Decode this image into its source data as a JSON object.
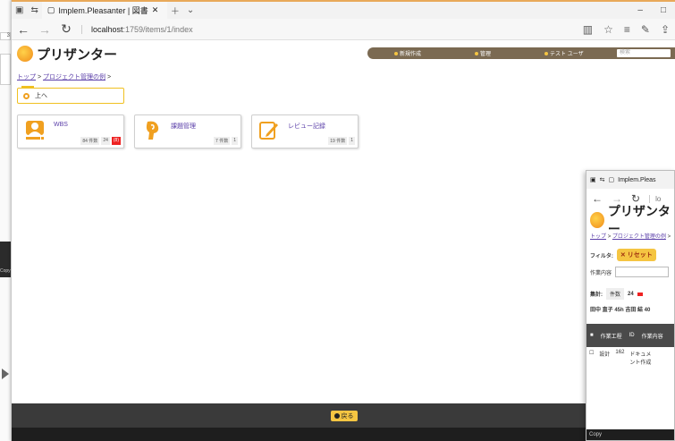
{
  "background_window": {
    "fragment_text": "3",
    "copyright_fragment": "Copy"
  },
  "browser": {
    "tab_title": "Implem.Pleasanter | 図書",
    "url_host": "localhost",
    "url_path": ":1759/items/1/index",
    "icons": [
      "back-icon",
      "forward-icon",
      "refresh-icon",
      "reading-view-icon",
      "favorite-icon",
      "hub-icon",
      "notes-icon",
      "share-icon"
    ]
  },
  "app": {
    "logo": "プリザンター",
    "menu": {
      "new": "新規作成",
      "manage": "管理",
      "user": "テスト ユーザ",
      "search_placeholder": "検索"
    },
    "breadcrumb": {
      "top": "トップ",
      "sep1": ">",
      "project": "プロジェクト管理の例",
      "sep2": ">"
    },
    "up_button": "上へ",
    "cards": [
      {
        "title": "WBS",
        "count_label": "84 件数",
        "n": "24",
        "badge": "(8)"
      },
      {
        "title": "課題管理",
        "count_label": "7 件数",
        "n": "1",
        "badge": ""
      },
      {
        "title": "レビュー記録",
        "count_label": "19 件数",
        "n": "1",
        "badge": ""
      }
    ],
    "back_button": "戻る",
    "copyright": "Copy"
  },
  "overlay_window": {
    "tab_title": "Implem.Pleas",
    "url": "lo",
    "logo": "プリザンター",
    "breadcrumb_top": "トップ",
    "breadcrumb_sep": ">",
    "breadcrumb_project": "プロジェクト管理の例",
    "filter_label": "フィルタ:",
    "reset_button": "リセット",
    "field_label": "作業内容",
    "summary_label": "集計:",
    "count_label": "件数",
    "count_value": "24",
    "names": "田中 直子 45h 吉田 結 40",
    "table_headers": [
      "作業工程",
      "ID",
      "作業内容"
    ],
    "row": {
      "phase": "設計",
      "id": "162",
      "content": "ドキュメント作成"
    },
    "copyright": "Copy"
  }
}
